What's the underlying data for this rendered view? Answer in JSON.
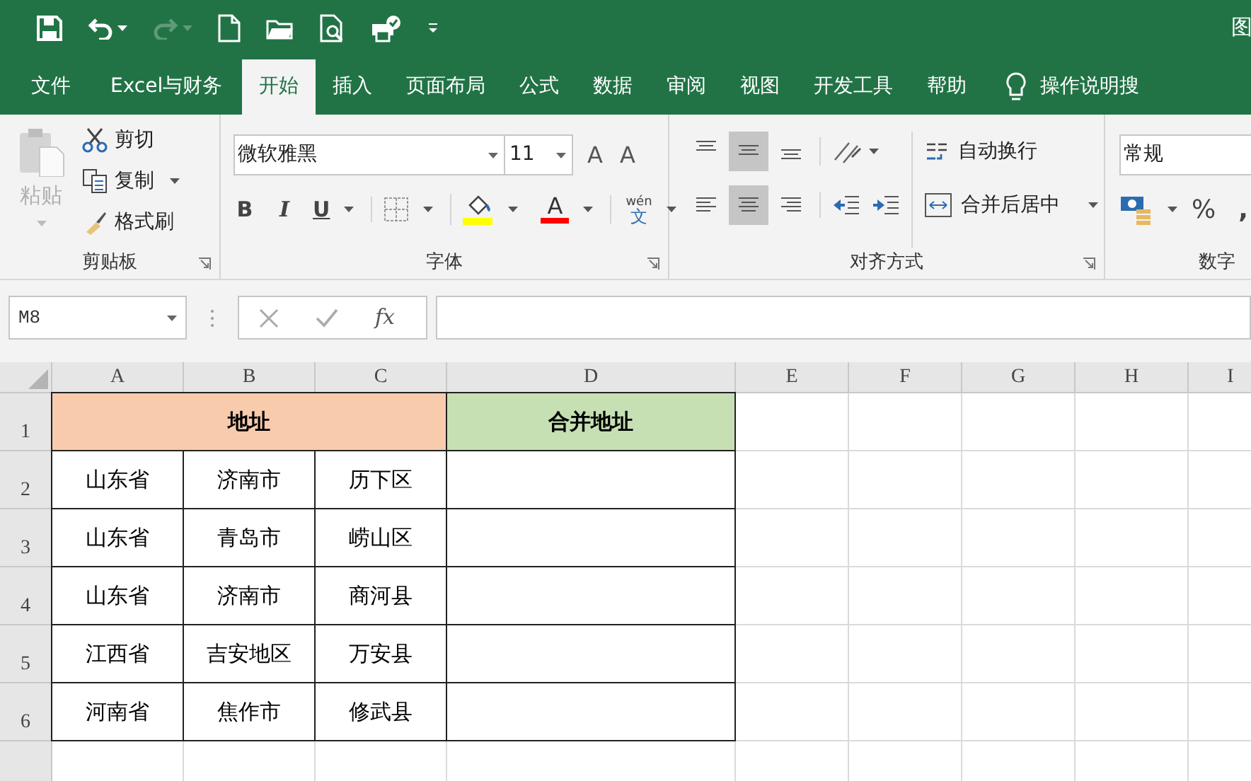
{
  "window": {
    "title": "图"
  },
  "tabs": [
    {
      "label": "文件",
      "selected": false
    },
    {
      "label": "Excel与财务",
      "selected": false
    },
    {
      "label": "开始",
      "selected": true
    },
    {
      "label": "插入",
      "selected": false
    },
    {
      "label": "页面布局",
      "selected": false
    },
    {
      "label": "公式",
      "selected": false
    },
    {
      "label": "数据",
      "selected": false
    },
    {
      "label": "审阅",
      "selected": false
    },
    {
      "label": "视图",
      "selected": false
    },
    {
      "label": "开发工具",
      "selected": false
    },
    {
      "label": "帮助",
      "selected": false
    }
  ],
  "tell_me": "操作说明搜",
  "clipboard": {
    "paste": "粘贴",
    "paste_disabled": true,
    "cut": "剪切",
    "copy": "复制",
    "format_painter": "格式刷",
    "label": "剪贴板"
  },
  "font": {
    "name": "微软雅黑",
    "size": "11",
    "grow": "A",
    "shrink": "A",
    "bold": "B",
    "italic": "I",
    "underline": "U",
    "font_color": "A",
    "phonetic_top": "wén",
    "phonetic": "文",
    "label": "字体"
  },
  "alignment": {
    "vertical": [
      {
        "selected": false
      },
      {
        "selected": true
      },
      {
        "selected": false
      }
    ],
    "horizontal": [
      {
        "selected": false
      },
      {
        "selected": true
      },
      {
        "selected": false
      }
    ],
    "wrap": "自动换行",
    "merge": "合并后居中",
    "label": "对齐方式"
  },
  "number": {
    "format": "常规",
    "percent": "%",
    "comma": ",",
    "label": "数字"
  },
  "formula_bar": {
    "name_box": "M8",
    "fx": "fx"
  },
  "columns": [
    "A",
    "B",
    "C",
    "D",
    "E",
    "F",
    "G",
    "H",
    "I"
  ],
  "header_row": {
    "row": "1",
    "cells": [
      {
        "text": "地址",
        "color": "#f8cbad"
      },
      {
        "text": "合并地址",
        "color": "#c6e0b4"
      }
    ]
  },
  "rows": [
    {
      "row": "2",
      "cells": [
        "山东省",
        "济南市",
        "历下区",
        ""
      ]
    },
    {
      "row": "3",
      "cells": [
        "山东省",
        "青岛市",
        "崂山区",
        ""
      ]
    },
    {
      "row": "4",
      "cells": [
        "山东省",
        "济南市",
        "商河县",
        ""
      ]
    },
    {
      "row": "5",
      "cells": [
        "江西省",
        "吉安地区",
        "万安县",
        ""
      ]
    },
    {
      "row": "6",
      "cells": [
        "河南省",
        "焦作市",
        "修武县",
        ""
      ]
    }
  ]
}
